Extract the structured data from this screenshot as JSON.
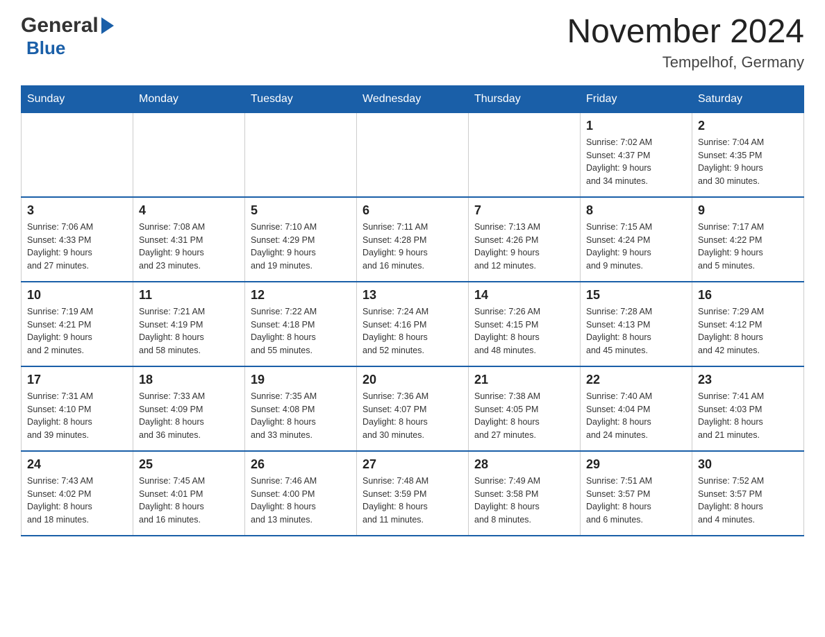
{
  "header": {
    "logo_general": "General",
    "logo_blue": "Blue",
    "month_title": "November 2024",
    "location": "Tempelhof, Germany"
  },
  "calendar": {
    "days_of_week": [
      "Sunday",
      "Monday",
      "Tuesday",
      "Wednesday",
      "Thursday",
      "Friday",
      "Saturday"
    ],
    "weeks": [
      [
        {
          "day": "",
          "info": ""
        },
        {
          "day": "",
          "info": ""
        },
        {
          "day": "",
          "info": ""
        },
        {
          "day": "",
          "info": ""
        },
        {
          "day": "",
          "info": ""
        },
        {
          "day": "1",
          "info": "Sunrise: 7:02 AM\nSunset: 4:37 PM\nDaylight: 9 hours\nand 34 minutes."
        },
        {
          "day": "2",
          "info": "Sunrise: 7:04 AM\nSunset: 4:35 PM\nDaylight: 9 hours\nand 30 minutes."
        }
      ],
      [
        {
          "day": "3",
          "info": "Sunrise: 7:06 AM\nSunset: 4:33 PM\nDaylight: 9 hours\nand 27 minutes."
        },
        {
          "day": "4",
          "info": "Sunrise: 7:08 AM\nSunset: 4:31 PM\nDaylight: 9 hours\nand 23 minutes."
        },
        {
          "day": "5",
          "info": "Sunrise: 7:10 AM\nSunset: 4:29 PM\nDaylight: 9 hours\nand 19 minutes."
        },
        {
          "day": "6",
          "info": "Sunrise: 7:11 AM\nSunset: 4:28 PM\nDaylight: 9 hours\nand 16 minutes."
        },
        {
          "day": "7",
          "info": "Sunrise: 7:13 AM\nSunset: 4:26 PM\nDaylight: 9 hours\nand 12 minutes."
        },
        {
          "day": "8",
          "info": "Sunrise: 7:15 AM\nSunset: 4:24 PM\nDaylight: 9 hours\nand 9 minutes."
        },
        {
          "day": "9",
          "info": "Sunrise: 7:17 AM\nSunset: 4:22 PM\nDaylight: 9 hours\nand 5 minutes."
        }
      ],
      [
        {
          "day": "10",
          "info": "Sunrise: 7:19 AM\nSunset: 4:21 PM\nDaylight: 9 hours\nand 2 minutes."
        },
        {
          "day": "11",
          "info": "Sunrise: 7:21 AM\nSunset: 4:19 PM\nDaylight: 8 hours\nand 58 minutes."
        },
        {
          "day": "12",
          "info": "Sunrise: 7:22 AM\nSunset: 4:18 PM\nDaylight: 8 hours\nand 55 minutes."
        },
        {
          "day": "13",
          "info": "Sunrise: 7:24 AM\nSunset: 4:16 PM\nDaylight: 8 hours\nand 52 minutes."
        },
        {
          "day": "14",
          "info": "Sunrise: 7:26 AM\nSunset: 4:15 PM\nDaylight: 8 hours\nand 48 minutes."
        },
        {
          "day": "15",
          "info": "Sunrise: 7:28 AM\nSunset: 4:13 PM\nDaylight: 8 hours\nand 45 minutes."
        },
        {
          "day": "16",
          "info": "Sunrise: 7:29 AM\nSunset: 4:12 PM\nDaylight: 8 hours\nand 42 minutes."
        }
      ],
      [
        {
          "day": "17",
          "info": "Sunrise: 7:31 AM\nSunset: 4:10 PM\nDaylight: 8 hours\nand 39 minutes."
        },
        {
          "day": "18",
          "info": "Sunrise: 7:33 AM\nSunset: 4:09 PM\nDaylight: 8 hours\nand 36 minutes."
        },
        {
          "day": "19",
          "info": "Sunrise: 7:35 AM\nSunset: 4:08 PM\nDaylight: 8 hours\nand 33 minutes."
        },
        {
          "day": "20",
          "info": "Sunrise: 7:36 AM\nSunset: 4:07 PM\nDaylight: 8 hours\nand 30 minutes."
        },
        {
          "day": "21",
          "info": "Sunrise: 7:38 AM\nSunset: 4:05 PM\nDaylight: 8 hours\nand 27 minutes."
        },
        {
          "day": "22",
          "info": "Sunrise: 7:40 AM\nSunset: 4:04 PM\nDaylight: 8 hours\nand 24 minutes."
        },
        {
          "day": "23",
          "info": "Sunrise: 7:41 AM\nSunset: 4:03 PM\nDaylight: 8 hours\nand 21 minutes."
        }
      ],
      [
        {
          "day": "24",
          "info": "Sunrise: 7:43 AM\nSunset: 4:02 PM\nDaylight: 8 hours\nand 18 minutes."
        },
        {
          "day": "25",
          "info": "Sunrise: 7:45 AM\nSunset: 4:01 PM\nDaylight: 8 hours\nand 16 minutes."
        },
        {
          "day": "26",
          "info": "Sunrise: 7:46 AM\nSunset: 4:00 PM\nDaylight: 8 hours\nand 13 minutes."
        },
        {
          "day": "27",
          "info": "Sunrise: 7:48 AM\nSunset: 3:59 PM\nDaylight: 8 hours\nand 11 minutes."
        },
        {
          "day": "28",
          "info": "Sunrise: 7:49 AM\nSunset: 3:58 PM\nDaylight: 8 hours\nand 8 minutes."
        },
        {
          "day": "29",
          "info": "Sunrise: 7:51 AM\nSunset: 3:57 PM\nDaylight: 8 hours\nand 6 minutes."
        },
        {
          "day": "30",
          "info": "Sunrise: 7:52 AM\nSunset: 3:57 PM\nDaylight: 8 hours\nand 4 minutes."
        }
      ]
    ]
  }
}
